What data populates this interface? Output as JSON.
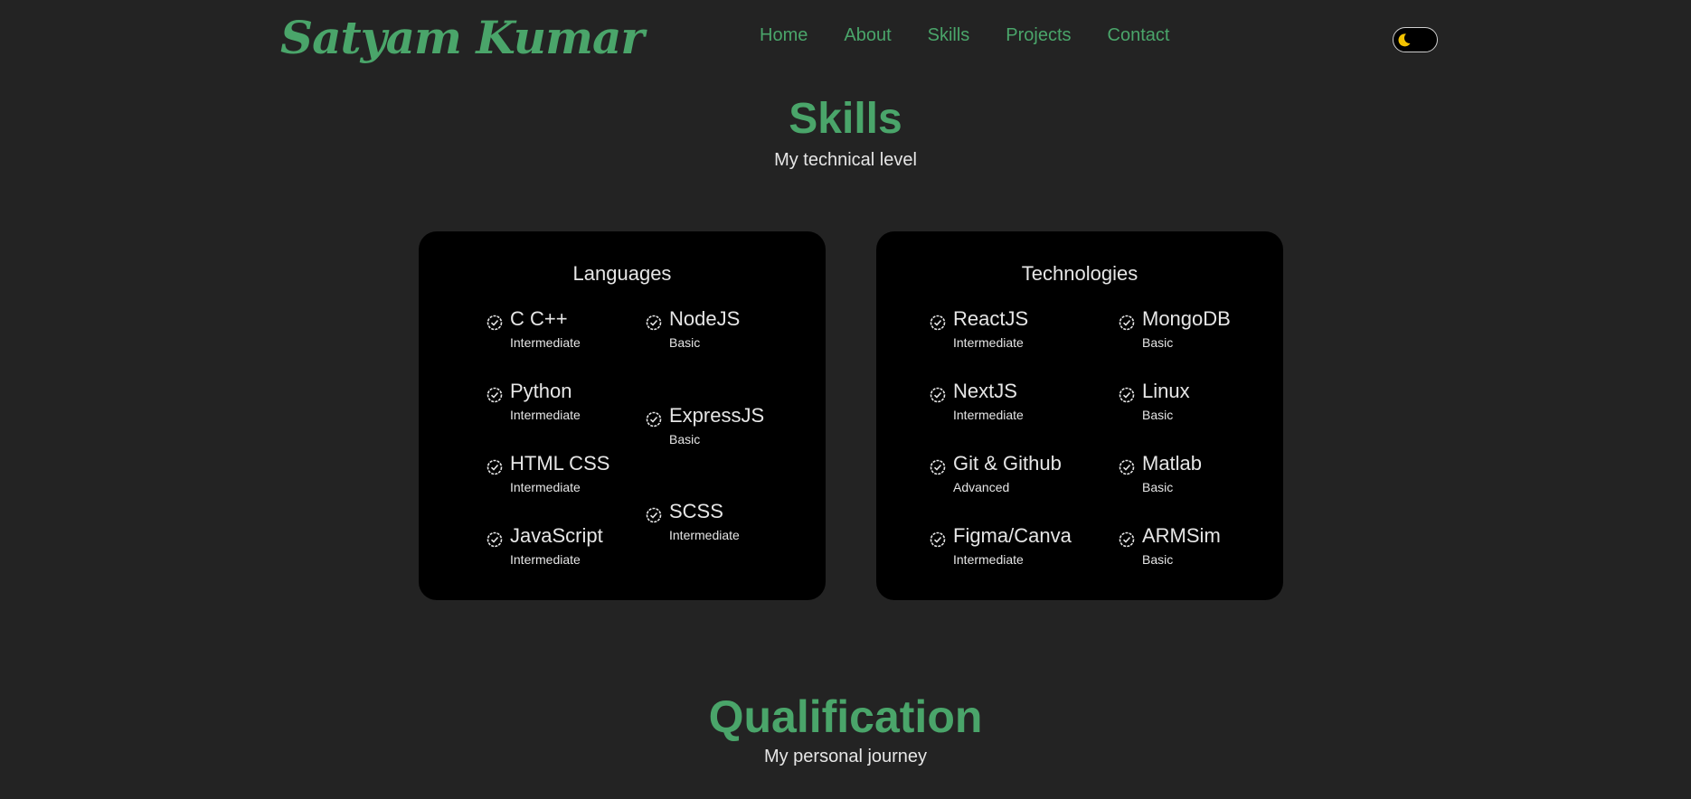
{
  "header": {
    "logo": "Satyam Kumar",
    "nav": [
      "Home",
      "About",
      "Skills",
      "Projects",
      "Contact"
    ],
    "theme_toggle_icon": "moon-icon"
  },
  "skills": {
    "title": "Skills",
    "subtitle": "My technical level"
  },
  "cards": {
    "languages": {
      "title": "Languages",
      "col1": [
        {
          "name": "C C++",
          "level": "Intermediate"
        },
        {
          "name": "Python",
          "level": "Intermediate"
        },
        {
          "name": "HTML CSS",
          "level": "Intermediate"
        },
        {
          "name": "JavaScript",
          "level": "Intermediate"
        }
      ],
      "col2": [
        {
          "name": "NodeJS",
          "level": "Basic"
        },
        {
          "name": "ExpressJS",
          "level": "Basic"
        },
        {
          "name": "SCSS",
          "level": "Intermediate"
        }
      ]
    },
    "technologies": {
      "title": "Technologies",
      "col1": [
        {
          "name": "ReactJS",
          "level": "Intermediate"
        },
        {
          "name": "NextJS",
          "level": "Intermediate"
        },
        {
          "name": "Git & Github",
          "level": "Advanced"
        },
        {
          "name": "Figma/Canva",
          "level": "Intermediate"
        }
      ],
      "col2": [
        {
          "name": "MongoDB",
          "level": "Basic"
        },
        {
          "name": "Linux",
          "level": "Basic"
        },
        {
          "name": "Matlab",
          "level": "Basic"
        },
        {
          "name": "ARMSim",
          "level": "Basic"
        }
      ]
    }
  },
  "qualification": {
    "title": "Qualification",
    "subtitle": "My personal journey"
  },
  "colors": {
    "accent": "#4aa56a",
    "background": "#232323",
    "card": "#000000",
    "text": "#e6e6e6"
  }
}
